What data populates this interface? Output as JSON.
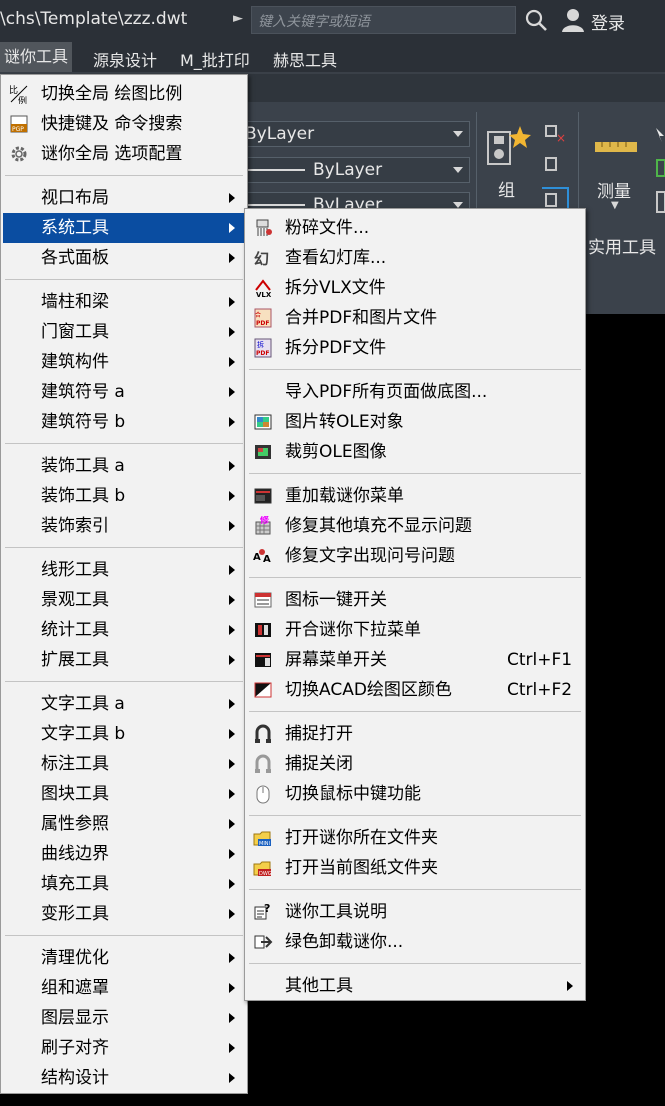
{
  "titlebar": {
    "path": "\\chs\\Template\\zzz.dwt",
    "arrow": "►",
    "search_placeholder": "键入关键字或短语",
    "login": "登录"
  },
  "menubar": {
    "items": [
      "谜你工具",
      "源泉设计",
      "M_批打印",
      "赫思工具"
    ]
  },
  "ribbon": {
    "combo1": "ByLayer",
    "combo2": "ByLayer",
    "combo3": "ByLayer",
    "group_label": "组",
    "measure_label": "测量",
    "utility_label": "实用工具"
  },
  "main_menu": {
    "top_items": [
      {
        "label": "切换全局 绘图比例",
        "icon": "scale-icon"
      },
      {
        "label": "快捷键及 命令搜索",
        "icon": "pgp-icon"
      },
      {
        "label": "谜你全局 选项配置",
        "icon": "gear-icon"
      }
    ],
    "groups": [
      [
        "视口布局",
        "系统工具",
        "各式面板"
      ],
      [
        "墙柱和梁",
        "门窗工具",
        "建筑构件",
        "建筑符号 a",
        "建筑符号 b"
      ],
      [
        "装饰工具 a",
        "装饰工具 b",
        "装饰索引"
      ],
      [
        "线形工具",
        "景观工具",
        "统计工具",
        "扩展工具"
      ],
      [
        "文字工具 a",
        "文字工具 b",
        "标注工具",
        "图块工具",
        "属性参照",
        "曲线边界",
        "填充工具",
        "变形工具"
      ],
      [
        "清理优化",
        "组和遮罩",
        "图层显示",
        "刷子对齐",
        "结构设计"
      ]
    ],
    "highlighted": "系统工具"
  },
  "sub_menu": {
    "groups": [
      [
        {
          "label": "粉碎文件...",
          "icon": "shred-icon"
        },
        {
          "label": "查看幻灯库...",
          "icon": "slide-icon"
        },
        {
          "label": "拆分VLX文件",
          "icon": "vlx-icon"
        },
        {
          "label": "合并PDF和图片文件",
          "icon": "pdf-merge-icon"
        },
        {
          "label": "拆分PDF文件",
          "icon": "pdf-split-icon"
        }
      ],
      [
        {
          "label": "导入PDF所有页面做底图...",
          "icon": ""
        },
        {
          "label": "图片转OLE对象",
          "icon": "image-ole-icon"
        },
        {
          "label": "裁剪OLE图像",
          "icon": "crop-ole-icon"
        }
      ],
      [
        {
          "label": "重加载谜你菜单",
          "icon": "reload-menu-icon"
        },
        {
          "label": "修复其他填充不显示问题",
          "icon": "hatch-fix-icon"
        },
        {
          "label": "修复文字出现问号问题",
          "icon": "text-fix-icon"
        }
      ],
      [
        {
          "label": "图标一键开关",
          "icon": "icon-toggle-icon",
          "shortcut": ""
        },
        {
          "label": "开合谜你下拉菜单",
          "icon": "dropdown-toggle-icon",
          "shortcut": ""
        },
        {
          "label": "屏幕菜单开关",
          "icon": "screen-menu-icon",
          "shortcut": "Ctrl+F1"
        },
        {
          "label": "切换ACAD绘图区颜色",
          "icon": "color-switch-icon",
          "shortcut": "Ctrl+F2"
        }
      ],
      [
        {
          "label": "捕捉打开",
          "icon": "snap-on-icon"
        },
        {
          "label": "捕捉关闭",
          "icon": "snap-off-icon"
        },
        {
          "label": "切换鼠标中键功能",
          "icon": "mouse-icon"
        }
      ],
      [
        {
          "label": "打开谜你所在文件夹",
          "icon": "folder-mini-icon"
        },
        {
          "label": "打开当前图纸文件夹",
          "icon": "folder-dwg-icon"
        }
      ],
      [
        {
          "label": "谜你工具说明",
          "icon": "help-icon"
        },
        {
          "label": "绿色卸载谜你...",
          "icon": "uninstall-icon"
        }
      ],
      [
        {
          "label": "其他工具",
          "icon": "",
          "submenu": true
        }
      ]
    ]
  },
  "colors": {
    "menu_bg": "#f2f2f2",
    "highlight": "#0a4da1",
    "titlebar": "#2b3037",
    "ribbon": "#3b424b"
  }
}
